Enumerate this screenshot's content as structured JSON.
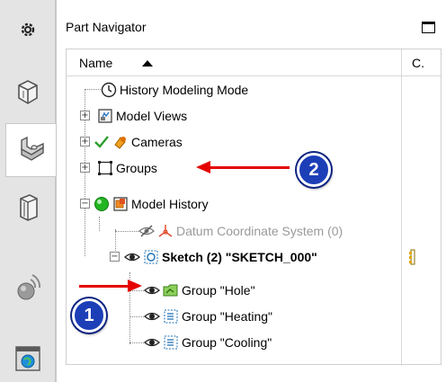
{
  "navigator": {
    "title": "Part Navigator",
    "col_name": "Name",
    "col_c": "C."
  },
  "tree": {
    "history_mode": "History Modeling Mode",
    "model_views": "Model Views",
    "cameras": "Cameras",
    "groups": "Groups",
    "model_history": "Model History",
    "datum_csys": "Datum Coordinate System (0)",
    "sketch": "Sketch (2) \"SKETCH_000\"",
    "group_hole": "Group \"Hole\"",
    "group_heating": "Group \"Heating\"",
    "group_cooling": "Group \"Cooling\""
  },
  "callouts": {
    "badge_1": "1",
    "badge_2": "2"
  },
  "colors": {
    "accent_red": "#e60000",
    "badge_blue": "#1c3fb8",
    "check_green": "#2e9e2e",
    "status_green": "#22b522"
  }
}
